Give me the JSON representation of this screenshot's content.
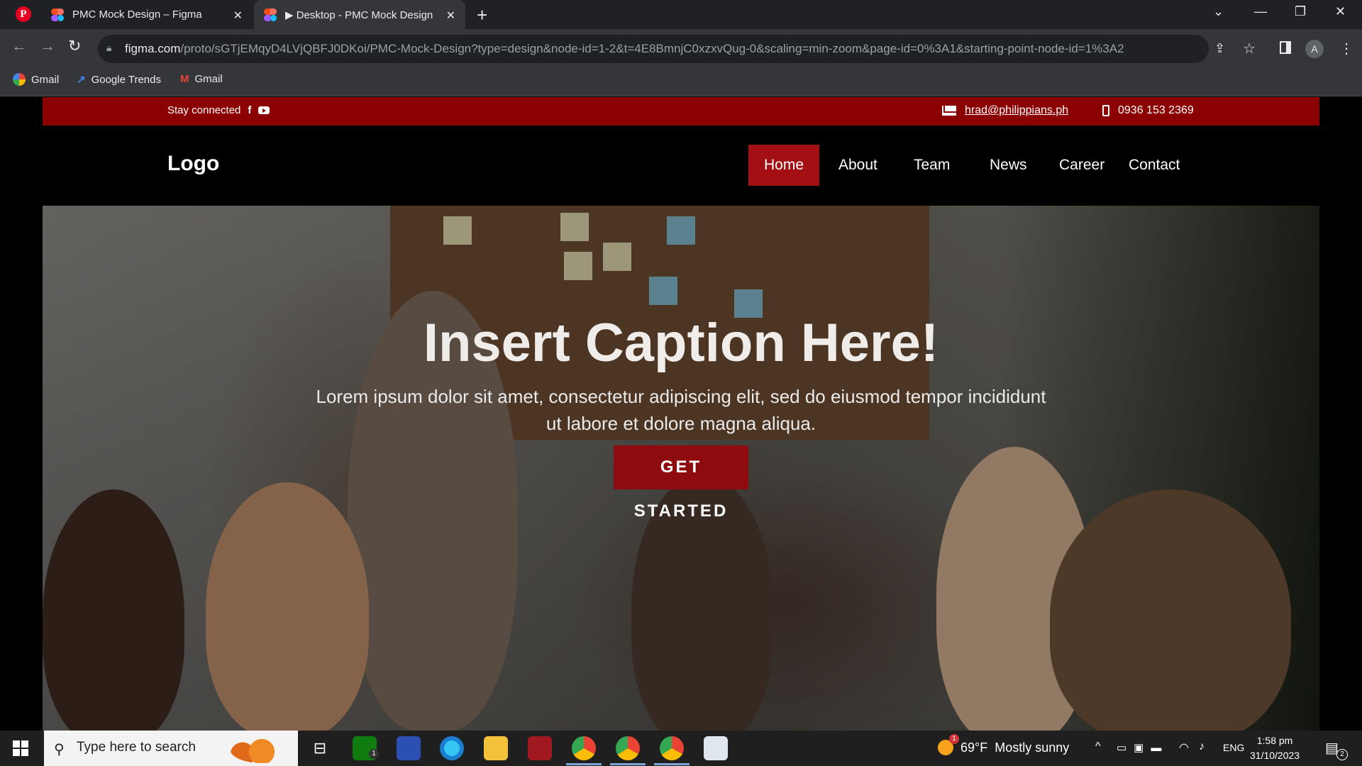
{
  "browser": {
    "tabs": [
      {
        "title": "PMC Mock Design – Figma",
        "active": false
      },
      {
        "title": "▶ Desktop - PMC Mock Design",
        "active": true
      }
    ],
    "url_host": "figma.com",
    "url_path": "/proto/sGTjEMqyD4LVjQBFJ0DKoi/PMC-Mock-Design?type=design&node-id=1-2&t=4E8BmnjC0xzxvQug-0&scaling=min-zoom&page-id=0%3A1&starting-point-node-id=1%3A2",
    "profile_initial": "A",
    "bookmarks": [
      "Gmail",
      "Google Trends",
      "Gmail"
    ]
  },
  "topbar": {
    "stay_connected": "Stay connected",
    "email": "hrad@philippians.ph",
    "phone": "0936 153 2369",
    "bg_color": "#8b0000"
  },
  "header": {
    "logo": "Logo",
    "nav": [
      "Home",
      "About",
      "Team",
      "News",
      "Career",
      "Contact"
    ],
    "active_nav": "Home",
    "accent": "#a30f12"
  },
  "hero": {
    "caption": "Insert Caption Here!",
    "lead": "Lorem ipsum dolor sit amet, consectetur adipiscing elit, sed do eiusmod tempor incididunt ut labore et dolore magna aliqua.",
    "cta": "GET STARTED"
  },
  "taskbar": {
    "search_placeholder": "Type here to search",
    "weather_temp": "69°F",
    "weather_desc": "Mostly sunny",
    "weather_badge": "1",
    "lang": "ENG",
    "time": "1:58 pm",
    "date": "31/10/2023",
    "notification_count": "2",
    "xbox_badge": "1"
  }
}
